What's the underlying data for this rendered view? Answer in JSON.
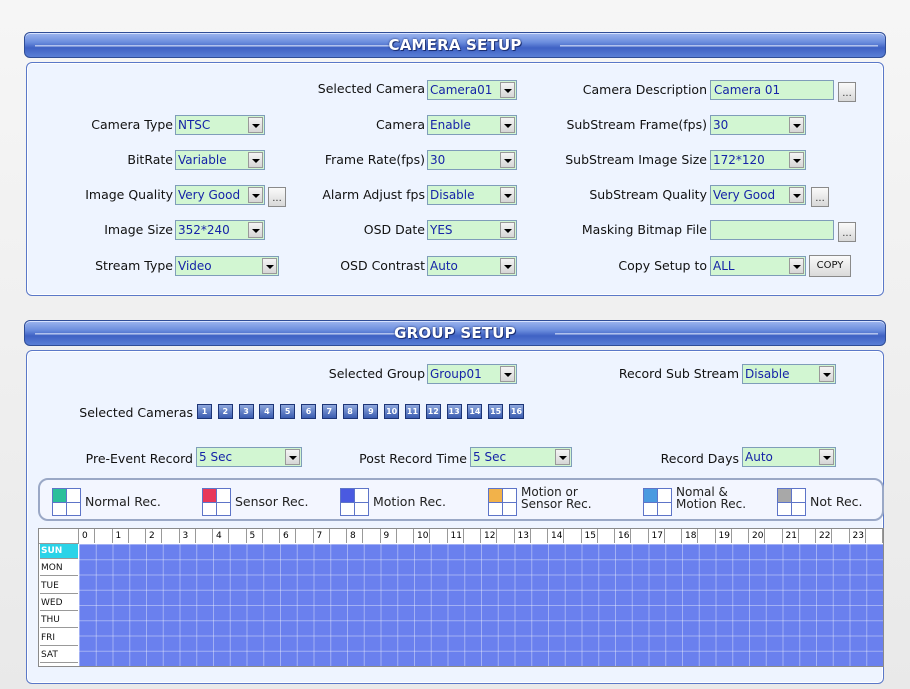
{
  "camera_setup": {
    "title": "CAMERA SETUP",
    "selected_camera": {
      "label": "Selected Camera",
      "value": "Camera01"
    },
    "camera_description": {
      "label": "Camera Description",
      "value": "Camera 01"
    },
    "camera_type": {
      "label": "Camera Type",
      "value": "NTSC"
    },
    "camera": {
      "label": "Camera",
      "value": "Enable"
    },
    "substream_frame": {
      "label": "SubStream Frame(fps)",
      "value": "30"
    },
    "bitrate": {
      "label": "BitRate",
      "value": "Variable"
    },
    "frame_rate": {
      "label": "Frame Rate(fps)",
      "value": "30"
    },
    "substream_image_size": {
      "label": "SubStream Image Size",
      "value": "172*120"
    },
    "image_quality": {
      "label": "Image Quality",
      "value": "Very Good"
    },
    "alarm_adjust": {
      "label": "Alarm Adjust fps",
      "value": "Disable"
    },
    "substream_quality": {
      "label": "SubStream Quality",
      "value": "Very Good"
    },
    "image_size": {
      "label": "Image Size",
      "value": "352*240"
    },
    "osd_date": {
      "label": "OSD Date",
      "value": "YES"
    },
    "masking_bitmap": {
      "label": "Masking Bitmap File",
      "value": ""
    },
    "stream_type": {
      "label": "Stream Type",
      "value": "Video"
    },
    "osd_contrast": {
      "label": "OSD Contrast",
      "value": "Auto"
    },
    "copy_setup": {
      "label": "Copy Setup to",
      "value": "ALL"
    },
    "copy_button": "COPY",
    "browse_button": "..."
  },
  "group_setup": {
    "title": "GROUP SETUP",
    "selected_group": {
      "label": "Selected Group",
      "value": "Group01"
    },
    "record_sub_stream": {
      "label": "Record Sub Stream",
      "value": "Disable"
    },
    "selected_cameras_label": "Selected Cameras",
    "cameras": [
      "1",
      "2",
      "3",
      "4",
      "5",
      "6",
      "7",
      "8",
      "9",
      "10",
      "11",
      "12",
      "13",
      "14",
      "15",
      "16"
    ],
    "pre_event": {
      "label": "Pre-Event Record",
      "value": "5 Sec"
    },
    "post_record": {
      "label": "Post Record Time",
      "value": "5 Sec"
    },
    "record_days": {
      "label": "Record Days",
      "value": "Auto"
    }
  },
  "legend": [
    {
      "label": "Normal Rec.",
      "color": "#2bbf9b"
    },
    {
      "label": "Sensor Rec.",
      "color": "#e8385a"
    },
    {
      "label": "Motion Rec.",
      "color": "#4a5ae0"
    },
    {
      "label": "Motion or Sensor Rec.",
      "line1": "Motion or",
      "line2": "Sensor Rec.",
      "color": "#f2b24a"
    },
    {
      "label": "Nomal & Motion Rec.",
      "line1": "Nomal &",
      "line2": "Motion Rec.",
      "color": "#4a9ae0"
    },
    {
      "label": "Not Rec.",
      "color": "#a8a8a8"
    }
  ],
  "schedule": {
    "hours": [
      "0",
      "1",
      "2",
      "3",
      "4",
      "5",
      "6",
      "7",
      "8",
      "9",
      "10",
      "11",
      "12",
      "13",
      "14",
      "15",
      "16",
      "17",
      "18",
      "19",
      "20",
      "21",
      "22",
      "23"
    ],
    "days": [
      "SUN",
      "MON",
      "TUE",
      "WED",
      "THU",
      "FRI",
      "SAT"
    ],
    "selected_day": "SUN",
    "fill_color": "#6a80ee",
    "mode": "Motion Rec."
  }
}
